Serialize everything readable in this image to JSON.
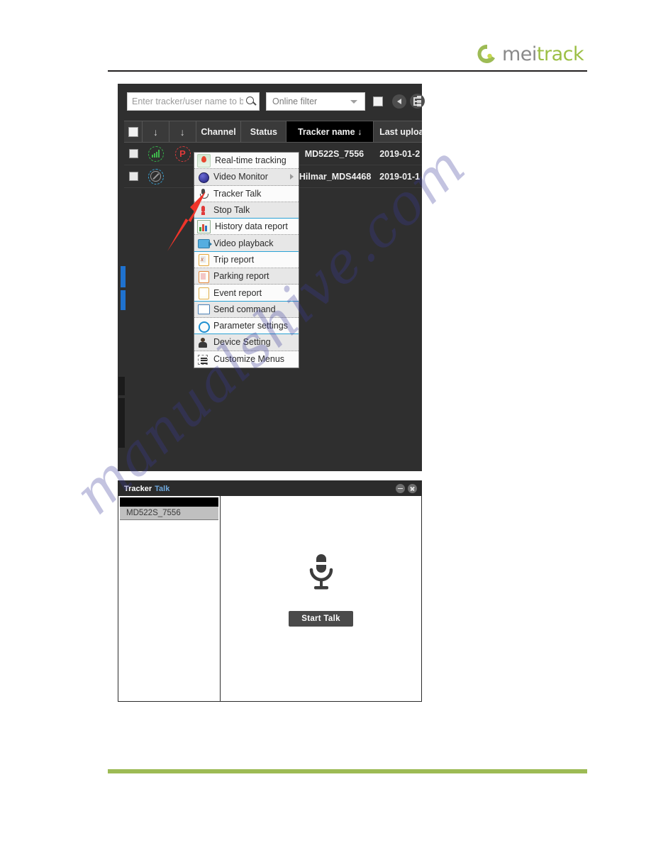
{
  "brand": {
    "name_part1": "mei",
    "name_part2": "track",
    "logo_icon": "meitrack-logo-icon",
    "green": "#9dbb55",
    "grey": "#8a8a8a"
  },
  "watermark": {
    "text": "manualshive.com"
  },
  "app": {
    "toolbar": {
      "search_placeholder": "Enter tracker/user name to be",
      "search_value": "",
      "search_icon": "search-icon",
      "filter_value": "Online filter",
      "filter_caret": "chevron-down-icon",
      "select_all_checkbox": "",
      "collapse_icon": "collapse-left-icon",
      "tree_icon": "tree-view-icon"
    },
    "table": {
      "columns": [
        {
          "key": "check",
          "label": "",
          "icon": "header-checkbox"
        },
        {
          "key": "sort1",
          "label": "↓",
          "icon": "sort-down-icon"
        },
        {
          "key": "sort2",
          "label": "↓",
          "icon": "sort-down-icon"
        },
        {
          "key": "channel",
          "label": "Channel"
        },
        {
          "key": "status",
          "label": "Status"
        },
        {
          "key": "tracker",
          "label": "Tracker name ↓",
          "selected": true
        },
        {
          "key": "upload",
          "label": "Last uploa"
        }
      ],
      "rows": [
        {
          "checked": false,
          "icons": [
            "signal-bars-icon",
            "parking-p-icon"
          ],
          "tracker_name": "MD522S_7556",
          "last_upload": "2019-01-2"
        },
        {
          "checked": false,
          "icons": [
            "no-entry-icon"
          ],
          "tracker_name": "Hilmar_MDS4468",
          "last_upload": "2019-01-1"
        }
      ]
    }
  },
  "context_menu": {
    "items": [
      {
        "label": "Real-time tracking",
        "icon": "map-pin-icon",
        "shade": "white"
      },
      {
        "label": "Video Monitor",
        "icon": "globe-icon",
        "shade": "grey",
        "submenu": true,
        "group_end": false
      },
      {
        "label": "Tracker Talk",
        "icon": "microphone-dark-icon",
        "shade": "white"
      },
      {
        "label": "Stop Talk",
        "icon": "microphone-red-icon",
        "shade": "grey",
        "group_end": true
      },
      {
        "label": "History data report",
        "icon": "bar-chart-icon",
        "shade": "white"
      },
      {
        "label": "Video playback",
        "icon": "video-camera-icon",
        "shade": "grey",
        "group_end": true
      },
      {
        "label": "Trip report",
        "icon": "clipboard-trip-icon",
        "shade": "white"
      },
      {
        "label": "Parking report",
        "icon": "clipboard-parking-icon",
        "shade": "grey"
      },
      {
        "label": "Event report",
        "icon": "clipboard-event-icon",
        "shade": "white",
        "group_end": true
      },
      {
        "label": "Send command",
        "icon": "window-command-icon",
        "shade": "grey"
      },
      {
        "label": "Parameter settings",
        "icon": "circle-outline-icon",
        "shade": "white",
        "group_end": true
      },
      {
        "label": "Device Setting",
        "icon": "person-icon",
        "shade": "grey"
      },
      {
        "label": "Customize Menus",
        "icon": "menu-lines-icon",
        "shade": "white",
        "last": true
      }
    ]
  },
  "annotation": {
    "arrow": "red-arrow-pointing-to-tracker-talk",
    "color": "#f0342a"
  },
  "dialog": {
    "title_part1": "Tracker",
    "title_part2": "Talk",
    "minimize_icon": "minimize-icon",
    "close_icon": "close-icon",
    "list": [
      {
        "label": "MD522S_7556",
        "selected": true
      }
    ],
    "mic_icon": "microphone-large-icon",
    "start_button": "Start Talk"
  }
}
